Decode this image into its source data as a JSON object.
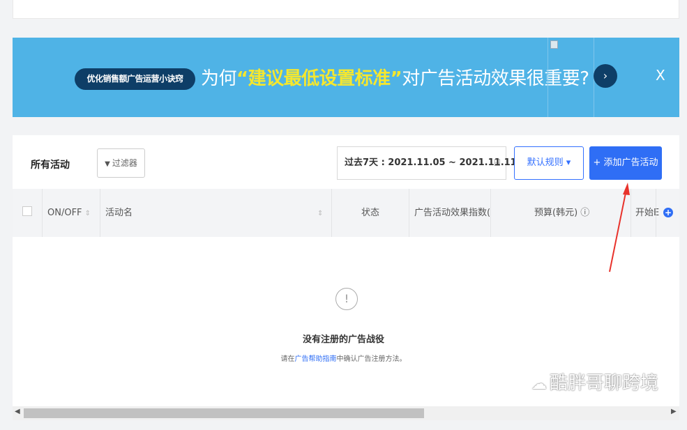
{
  "banner": {
    "pill": "优化销售额广告运营小诀窍",
    "text_before": "为何",
    "text_highlight": "“建议最低设置标准”",
    "text_after": "对广告活动效果很重要?",
    "next_icon": "›",
    "close": "X"
  },
  "toolbar": {
    "all_campaigns": "所有活动",
    "filter_icon": "▼",
    "filter_label": "过滤器",
    "date_range": "过去7天 : 2021.11.05 ~ 2021.11.11",
    "calendar_icon": "⌸",
    "rule_label": "默认规则 ▾",
    "add_label": "+ 添加广告活动"
  },
  "table": {
    "columns": [
      "ON/OFF",
      "活动名",
      "状态",
      "广告活动效果指数(",
      "预算(韩元) ⓘ",
      "开始E"
    ],
    "sort_icon": "⇕",
    "add_column_icon": "+"
  },
  "empty": {
    "icon": "!",
    "title": "没有注册的广告战役",
    "hint_before": "请在",
    "hint_link": "广告帮助指南",
    "hint_after": "中确认广告注册方法。"
  },
  "watermark": {
    "icon": "☁",
    "text": "酷胖哥聊跨境"
  },
  "scrollbar": {
    "left": "◀",
    "right": "▶"
  },
  "colors": {
    "banner_bg": "#4fb3e6",
    "banner_highlight": "#f5e72e",
    "primary": "#2f6ef5",
    "annotation_arrow": "#e8322b"
  }
}
